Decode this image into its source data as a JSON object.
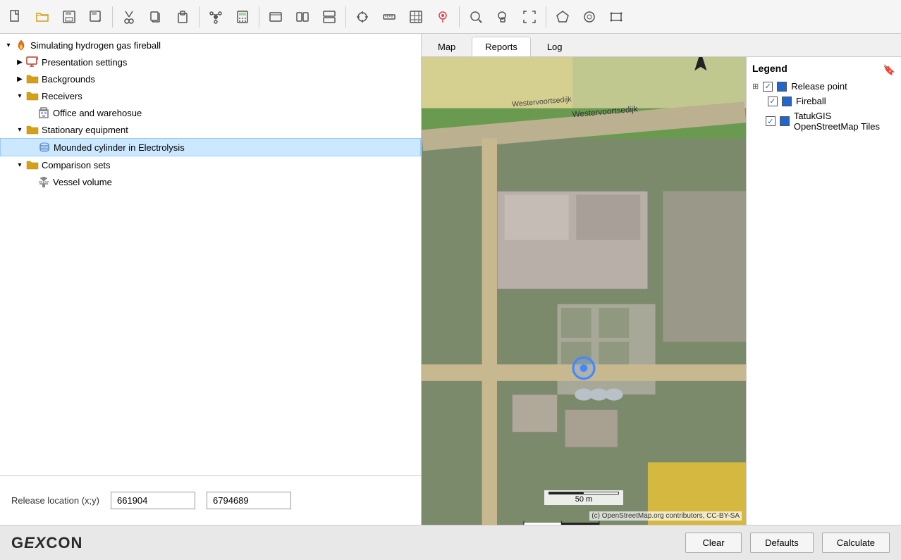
{
  "toolbar": {
    "buttons": [
      {
        "name": "new-file",
        "icon": "📄",
        "label": "New"
      },
      {
        "name": "open-folder",
        "icon": "📂",
        "label": "Open"
      },
      {
        "name": "save",
        "icon": "💾",
        "label": "Save"
      },
      {
        "name": "save-as",
        "icon": "📥",
        "label": "Save As"
      },
      {
        "name": "cut",
        "icon": "✂",
        "label": "Cut"
      },
      {
        "name": "copy",
        "icon": "📋",
        "label": "Copy"
      },
      {
        "name": "paste",
        "icon": "📌",
        "label": "Paste"
      },
      {
        "name": "network",
        "icon": "🔗",
        "label": "Network"
      },
      {
        "name": "calculator",
        "icon": "🧮",
        "label": "Calculator"
      },
      {
        "name": "window-view",
        "icon": "▭",
        "label": "Window"
      },
      {
        "name": "split-h",
        "icon": "⬛",
        "label": "Split H"
      },
      {
        "name": "split-v",
        "icon": "≡",
        "label": "Split V"
      },
      {
        "name": "crosshair",
        "icon": "⊕",
        "label": "Crosshair"
      },
      {
        "name": "ruler",
        "icon": "📏",
        "label": "Ruler"
      },
      {
        "name": "grid",
        "icon": "⊞",
        "label": "Grid"
      },
      {
        "name": "pin",
        "icon": "📍",
        "label": "Pin"
      },
      {
        "name": "search-zoom",
        "icon": "🔍",
        "label": "Zoom"
      },
      {
        "name": "zoom-fit",
        "icon": "⛶",
        "label": "Fit"
      },
      {
        "name": "zoom-extent",
        "icon": "⤢",
        "label": "Extent"
      },
      {
        "name": "pentagon",
        "icon": "⬠",
        "label": "Pentagon"
      },
      {
        "name": "circle-tool",
        "icon": "◎",
        "label": "Circle"
      },
      {
        "name": "rect-tool",
        "icon": "▣",
        "label": "Rectangle"
      }
    ]
  },
  "tree": {
    "root": {
      "label": "Simulating hydrogen gas fireball",
      "icon": "fire",
      "expanded": true,
      "children": [
        {
          "label": "Presentation settings",
          "icon": "presentation",
          "indent": 1,
          "expanded": false
        },
        {
          "label": "Backgrounds",
          "icon": "folder",
          "indent": 1,
          "expanded": false
        },
        {
          "label": "Receivers",
          "icon": "folder",
          "indent": 1,
          "expanded": true,
          "children": [
            {
              "label": "Office and warehosue",
              "icon": "building",
              "indent": 2
            }
          ]
        },
        {
          "label": "Stationary equipment",
          "icon": "folder",
          "indent": 1,
          "expanded": true,
          "children": [
            {
              "label": "Mounded cylinder in Electrolysis",
              "icon": "cylinder",
              "indent": 2,
              "selected": true
            }
          ]
        },
        {
          "label": "Comparison sets",
          "icon": "folder",
          "indent": 1,
          "expanded": true,
          "children": [
            {
              "label": "Vessel volume",
              "icon": "scale",
              "indent": 2
            }
          ]
        }
      ]
    }
  },
  "tabs": {
    "map": "Map",
    "reports": "Reports",
    "log": "Log",
    "active": "Reports"
  },
  "bottom": {
    "release_location_label": "Release location (x;y)",
    "x_value": "661904",
    "y_value": "6794689",
    "x_placeholder": "661904",
    "y_placeholder": "6794689"
  },
  "legend": {
    "title": "Legend",
    "items": [
      {
        "label": "Release point",
        "color": "#2266cc",
        "checked": true
      },
      {
        "label": "Fireball",
        "color": "#2266cc",
        "checked": true
      },
      {
        "label": "TatukGIS OpenStreetMap Tiles",
        "color": "#2266cc",
        "checked": true
      }
    ]
  },
  "map": {
    "scale_label": "50 m",
    "attribution": "(c) OpenStreetMap.org contributors, CC-BY-SA",
    "north_label": "N",
    "road_label_1": "Westervoortsedijk",
    "road_label_2": "Westervoortsedijk"
  },
  "action_bar": {
    "logo": "GEXCON",
    "clear_btn": "Clear",
    "defaults_btn": "Defaults",
    "calculate_btn": "Calculate"
  }
}
